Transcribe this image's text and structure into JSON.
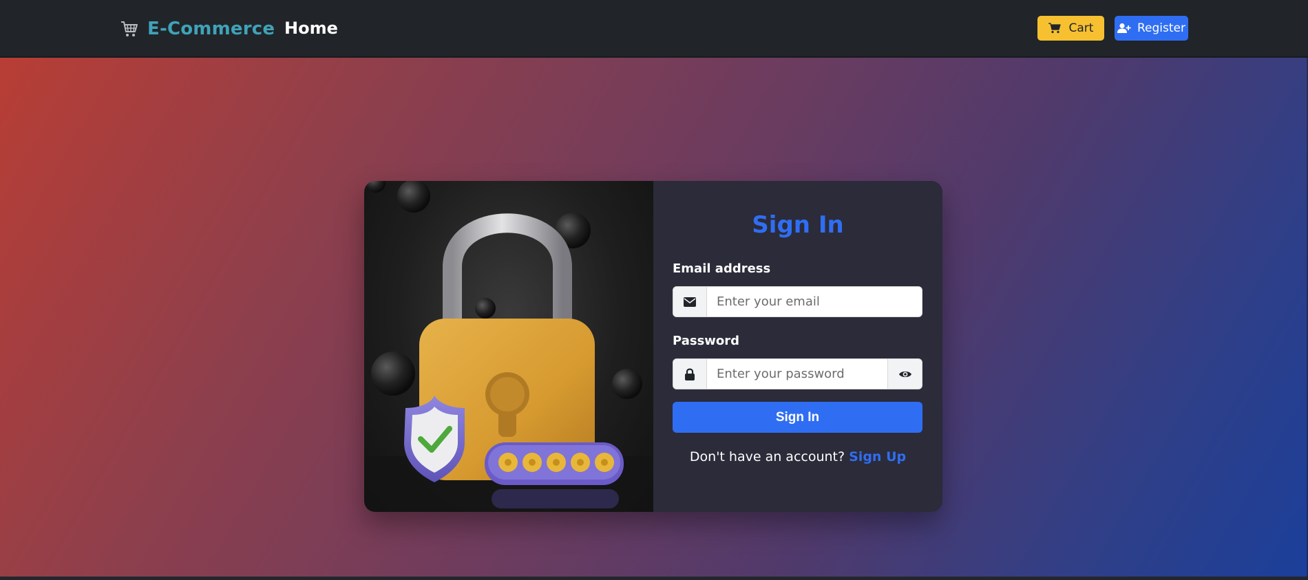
{
  "navbar": {
    "brand": "E-Commerce",
    "home": "Home",
    "cart_label": "Cart",
    "register_label": "Register"
  },
  "login": {
    "title": "Sign In",
    "email_label": "Email address",
    "email_placeholder": "Enter your email",
    "password_label": "Password",
    "password_placeholder": "Enter your password",
    "submit_label": "Sign In",
    "signup_prompt": "Don't have an account?",
    "signup_link": "Sign Up"
  },
  "icons": {
    "brand": "shopping-cart-icon",
    "cart": "cart-icon",
    "register": "user-plus-icon",
    "email": "envelope-icon",
    "password": "lock-icon",
    "toggle": "eye-icon"
  },
  "colors": {
    "navbar_bg": "#212529",
    "brand": "#3fa3b9",
    "primary": "#2f6ef3",
    "warning": "#f7c031",
    "form_bg": "#2b2b3a",
    "gradient_start": "#b83e35",
    "gradient_end": "#1b3f9a"
  }
}
